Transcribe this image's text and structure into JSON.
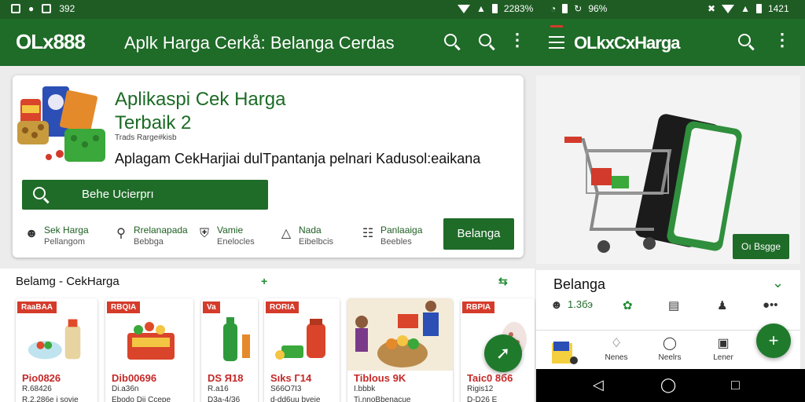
{
  "status_left": {
    "time": "392"
  },
  "status_mid": {
    "battery_pct": "2283%"
  },
  "status_mid2": {
    "battery_pct": "96%"
  },
  "status_right": {
    "time": "1421"
  },
  "appbar_left": {
    "logo": "OLx888",
    "title": "Aplk Harga Cerkå: Belanga Cerdas"
  },
  "appbar_right": {
    "logo": "OLkxCxHarga"
  },
  "hero": {
    "title_line1": "Aplikaspi Cek Harga",
    "title_line2": "Terbaik 2",
    "small": "Trads Rarge#kisb",
    "subtitle": "Aplagam CekHarjiai dulTpantanja pelnari Kadusol:eaikana",
    "search_label": "Behe Ucierprı",
    "features": [
      {
        "line1": "Sek Harga",
        "line2": "Pellangom",
        "icon": "person-icon"
      },
      {
        "line1": "Rrelanapada",
        "line2": "Bebbga",
        "icon": "wrench-icon"
      },
      {
        "line1": "Vamie",
        "line2": "Enelocles",
        "icon": "shield-icon"
      },
      {
        "line1": "Nada",
        "line2": "Eibelbcis",
        "icon": "megaphone-icon"
      },
      {
        "line1": "Panlaaiga",
        "line2": "Beebles",
        "icon": "document-icon"
      }
    ],
    "cta": "Belanga"
  },
  "products": {
    "heading": "Belamg - CekHarga",
    "items": [
      {
        "tag": "RaaBAA",
        "price": "Pio0826",
        "line1": "R.68426",
        "line2": "R,2,286e   i sovie"
      },
      {
        "tag": "RBQIA",
        "price": "Dib00696",
        "line1": "Di.a36n",
        "line2": "Ebodo Dii Ccepe"
      },
      {
        "tag": "Va",
        "price": "DS Я18",
        "line1": "R.a16",
        "line2": "D3a-4/36"
      },
      {
        "tag": "RORIA",
        "price": "Sıks Г14",
        "line1": "S66O7I3",
        "line2": "d-dd6uu  bveie"
      },
      {
        "tag": "",
        "price": "Tiblous 9K",
        "line1": "I.bbbk",
        "line2": "Ti,nnoBbenacue"
      },
      {
        "tag": "RBPIA",
        "price": "Taic0 8б6",
        "line1": "Rigis12",
        "line2": "D-D26   E"
      }
    ]
  },
  "right": {
    "cek_btn": "Oı Bsgge",
    "panel_title": "Belanga",
    "count": "1.3бэ",
    "bottom": [
      {
        "label": "Nenes",
        "icon": "bag-icon"
      },
      {
        "label": "Neelrs",
        "icon": "circle-icon"
      },
      {
        "label": "Lener",
        "icon": "tv-icon"
      }
    ]
  },
  "colors": {
    "primary": "#1f6b28",
    "accent_red": "#d53b2b",
    "price_red": "#c62828"
  }
}
